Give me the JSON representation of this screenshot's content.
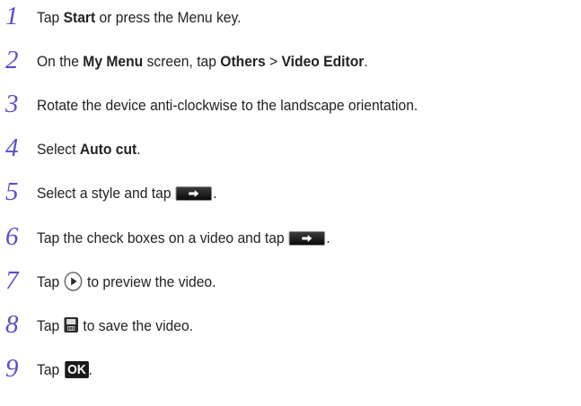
{
  "steps": [
    {
      "number": "1",
      "pre": "Tap ",
      "b1": "Start",
      "post": " or press the Menu key."
    },
    {
      "number": "2",
      "pre": "On the ",
      "b1": "My Menu",
      "mid1": " screen, tap ",
      "b2": "Others",
      "mid2": " > ",
      "b3": "Video Editor",
      "post": "."
    },
    {
      "number": "3",
      "text": "Rotate the device anti-clockwise to the landscape orientation."
    },
    {
      "number": "4",
      "pre": "Select ",
      "b1": "Auto cut",
      "post": "."
    },
    {
      "number": "5",
      "pre": "Select a style and tap ",
      "post": "."
    },
    {
      "number": "6",
      "pre": "Tap the check boxes on a video and tap ",
      "post": "."
    },
    {
      "number": "7",
      "pre": "Tap ",
      "post": " to preview the video."
    },
    {
      "number": "8",
      "pre": "Tap ",
      "post": " to save the video."
    },
    {
      "number": "9",
      "pre": "Tap ",
      "ok_label": "OK",
      "post": "."
    }
  ],
  "icons": {
    "next": "arrow-right-icon",
    "play": "play-icon",
    "save": "save-icon"
  },
  "colors": {
    "step_number": "#5a4fc7",
    "text": "#222222",
    "icon_dark": "#1a1a1a"
  }
}
